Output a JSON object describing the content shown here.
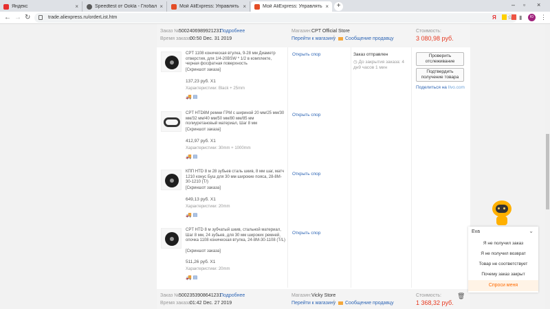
{
  "browser": {
    "tabs": [
      {
        "label": "Яндекс",
        "icon": "yandex-favicon",
        "color": "#e62e2e"
      },
      {
        "label": "Speedtest от Ookla - Глобальн",
        "icon": "speedtest-favicon",
        "color": "#5a5a5a"
      },
      {
        "label": "Мой AliExpress: Управлять зака",
        "icon": "aliexpress-favicon",
        "color": "#e44d26"
      },
      {
        "label": "Мой AliExpress: Управлять зака",
        "icon": "aliexpress-favicon",
        "color": "#e44d26",
        "active": true
      }
    ],
    "url": "trade.aliexpress.ru/orderList.htm",
    "avatar_initials": "Ю"
  },
  "orders": [
    {
      "number_label": "Заказ №:",
      "number": "5002406989921231",
      "details_link": "Подробнее",
      "time_label": "Время заказа:",
      "time": "00:50 Dec. 31 2019",
      "store_label": "Магазин:",
      "store": "CPT Official Store",
      "go_store": "Перейти к магазину",
      "message_seller": "Сообщение продавцу",
      "cost_label": "Стоимость:",
      "cost": "3 080,98 руб.",
      "status": "Заказ отправлен",
      "auto_close": "До закрытия заказа: 4 дн9 часов 1 мин",
      "btn_track": "Проверить отслеживание",
      "btn_confirm": "Подтвердить получение товара",
      "share_prefix": "Поделиться на",
      "share_site": "Ilvo.com",
      "items": [
        {
          "title": "CPT 1108 коническая втулка, 9-28 мм Диаметр отверстия, для 1/4-20BSW * 1/2 в комплекте, черная фосфатная поверхность",
          "snapshot": "[Скриншот заказа]",
          "price": "137,23 руб. X1",
          "spec": "Характеристики: Black + 25mm",
          "dispute": "Открыть спор",
          "kind": "wheel"
        },
        {
          "title": "CPT HTD8M ремни ГРМ с шириной 20 мм/25 мм/30 мм/32 мм/40 мм/50 мм/80 мм/85 мм полиуретановый материал, Шаг 8 мм",
          "snapshot": "[Скриншот заказа]",
          "price": "412,97 руб. X1",
          "spec": "Характеристики: 30mm + 1000mm",
          "dispute": "Открыть спор",
          "kind": "belt"
        },
        {
          "title": "КПП HTD 8 м 28 зубьев сталь шкив, 8 мм шаг, матч 1210 конус Буш для 30 мм широкие пояса, 28-8M-30-1210 (T/)",
          "snapshot": "[Скриншот заказа]",
          "price": "649,13 руб. X1",
          "spec": "Характеристики: 20mm",
          "dispute": "Открыть спор",
          "kind": "wheel"
        },
        {
          "title": "CPT HTD 8 м зубчатый шкив, стальной материал, Шаг 8 мм, 24 зубьев, для 30 мм широких ремней, опочка 1108 коническая втулка, 24-8M-30-1108 (T/L)",
          "snapshot": "[Скриншот заказа]",
          "price": "511,26 руб. X1",
          "spec": "Характеристики: 20mm",
          "dispute": "Открыть спор",
          "kind": "wheel"
        }
      ]
    },
    {
      "number_label": "Заказ №:",
      "number": "5002353908641231",
      "details_link": "Подробнее",
      "time_label": "Время заказа:",
      "time": "01:42 Dec. 27 2019",
      "store_label": "Магазин:",
      "store": "Vicky Store",
      "go_store": "Перейти к магазину",
      "message_seller": "Сообщение продавцу",
      "cost_label": "Стоимость:",
      "cost": "1 368,32 руб."
    }
  ],
  "chat": {
    "name": "Eva",
    "options": [
      "Я не получил заказ",
      "Я не получил возврат",
      "Товар не соответствует",
      "Почему заказ закрыт"
    ],
    "ask": "Спроси меня"
  }
}
